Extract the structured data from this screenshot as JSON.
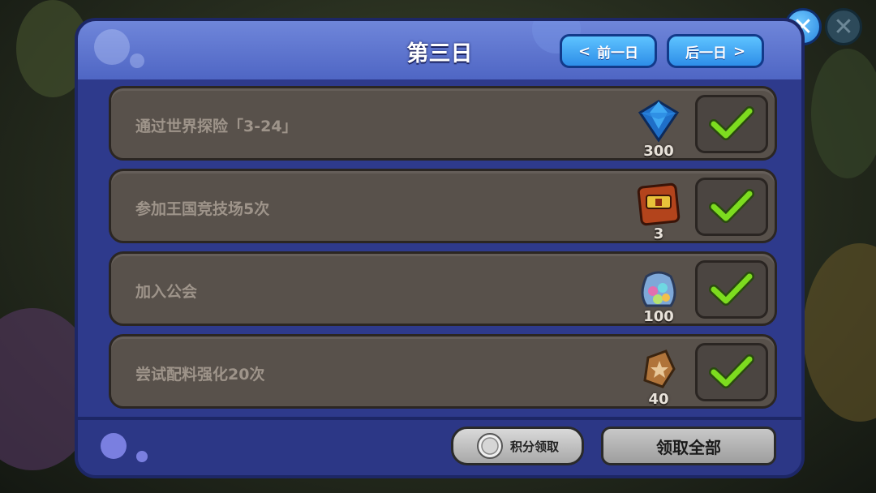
{
  "dialog": {
    "title": "第三日",
    "prev_label": "前一日",
    "next_label": "后一日"
  },
  "quests": [
    {
      "text": "通过世界探险「3-24」",
      "reward_icon": "diamond-icon",
      "reward_count": "300",
      "completed": true
    },
    {
      "text": "参加王国竞技场5次",
      "reward_icon": "treasure-chest-icon",
      "reward_count": "3",
      "completed": true
    },
    {
      "text": "加入公会",
      "reward_icon": "gem-bag-icon",
      "reward_count": "100",
      "completed": true
    },
    {
      "text": "尝试配料强化20次",
      "reward_icon": "star-crystal-icon",
      "reward_count": "40",
      "completed": true
    }
  ],
  "footer": {
    "points_claim_label": "积分领取",
    "claim_all_label": "领取全部"
  },
  "colors": {
    "panel": "#2e3a8c",
    "header": "#5a72cc",
    "nav_button": "#3aa3f2",
    "quest_row": "#58514b",
    "check": "#7ddc1f"
  }
}
